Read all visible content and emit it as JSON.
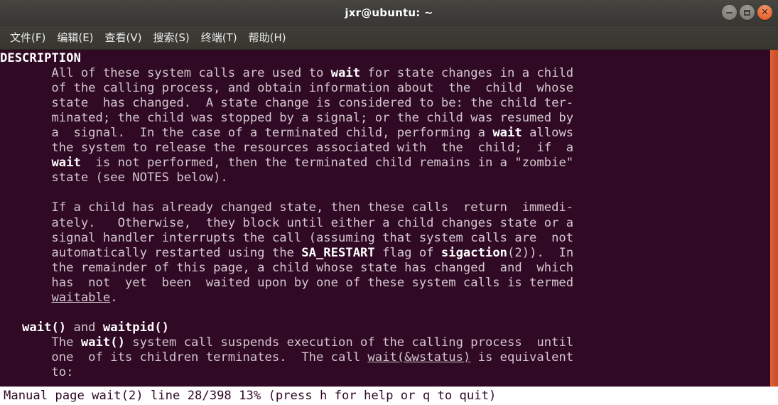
{
  "titlebar": {
    "title": "jxr@ubuntu: ~",
    "controls": [
      {
        "name": "minimize",
        "glyph": "–"
      },
      {
        "name": "maximize",
        "glyph": "□"
      },
      {
        "name": "close",
        "glyph": "✕"
      }
    ]
  },
  "menubar": {
    "items": [
      {
        "label": "文件(F)"
      },
      {
        "label": "编辑(E)"
      },
      {
        "label": "查看(V)"
      },
      {
        "label": "搜索(S)"
      },
      {
        "label": "终端(T)"
      },
      {
        "label": "帮助(H)"
      }
    ]
  },
  "terminal": {
    "background_color": "#300a24",
    "foreground_color": "#d3c6cd",
    "bold_color": "#ffffff",
    "scrollbar_color": "#d9562c",
    "man_page": {
      "section_heading": "DESCRIPTION",
      "lines": [
        "DESCRIPTION",
        "       All of these system calls are used to wait for state changes in a child",
        "       of the calling process, and obtain information about  the  child  whose",
        "       state  has changed.  A state change is considered to be: the child ter-",
        "       minated; the child was stopped by a signal; or the child was resumed by",
        "       a  signal.  In the case of a terminated child, performing a wait allows",
        "       the system to release the resources associated with  the  child;  if  a",
        "       wait  is not performed, then the terminated child remains in a \"zombie\"",
        "       state (see NOTES below).",
        "",
        "       If a child has already changed state, then these calls  return  immedi-",
        "       ately.   Otherwise,  they block until either a child changes state or a",
        "       signal handler interrupts the call (assuming that system calls are  not",
        "       automatically restarted using the SA_RESTART flag of sigaction(2)).  In",
        "       the remainder of this page, a child whose state has changed  and  which",
        "       has  not  yet  been  waited upon by one of these system calls is termed",
        "       waitable.",
        "",
        "   wait() and waitpid()",
        "       The wait() system call suspends execution of the calling process  until",
        "       one  of its children terminates.  The call wait(&wstatus) is equivalent",
        "       to:"
      ],
      "bold_tokens": [
        "DESCRIPTION",
        "SA_RESTART",
        "sigaction",
        "wait()",
        "waitpid()",
        "wait"
      ],
      "underlined_tokens": [
        "waitable",
        "wait(&wstatus)"
      ]
    }
  },
  "statusline": {
    "text": "Manual page wait(2) line 28/398 13% (press h for help or q to quit)",
    "manual_name": "wait(2)",
    "line_current": 28,
    "line_total": 398,
    "percent": "13%",
    "hint": "(press h for help or q to quit)"
  }
}
